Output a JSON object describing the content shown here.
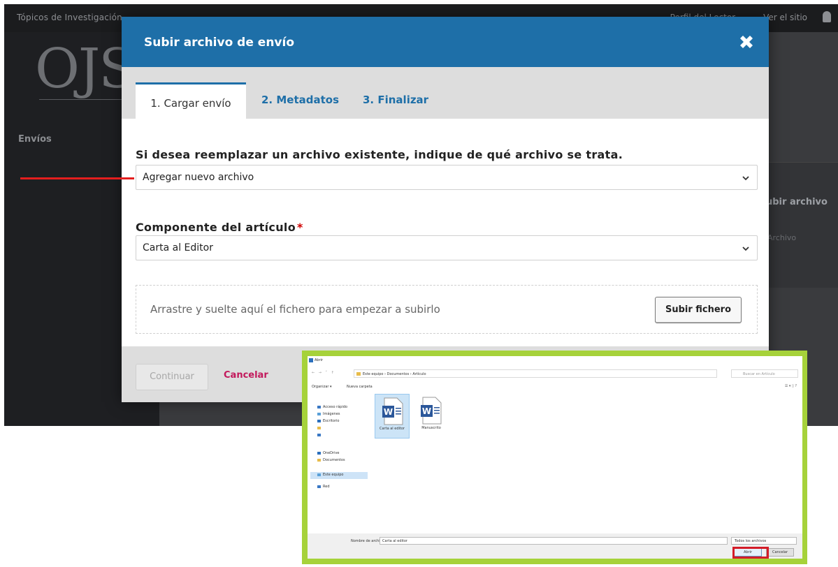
{
  "background": {
    "topbar_left": "Tópicos de Investigación",
    "topbar_right_1": "Perfil del Lector",
    "topbar_right_2": "Ver el sitio",
    "logo_text": "OJS",
    "sidebar_item": "Envíos",
    "panel_link": "ubir archivo",
    "panel_small": "Archivo"
  },
  "modal": {
    "title": "Subir archivo de envío",
    "tabs": [
      {
        "label": "1. Cargar envío"
      },
      {
        "label": "2. Metadatos"
      },
      {
        "label": "3. Finalizar"
      }
    ],
    "replace_label": "Si desea reemplazar un archivo existente, indique de qué archivo se trata.",
    "replace_value": "Agregar nuevo archivo",
    "component_label": "Componente del artículo",
    "required_mark": "*",
    "component_value": "Carta al Editor",
    "dropzone_text": "Arrastre y suelte aquí el fichero para empezar a subirlo",
    "upload_button": "Subir fichero",
    "continue_button": "Continuar",
    "cancel_button": "Cancelar"
  },
  "colors": {
    "header_blue": "#1e6fa8",
    "link_blue": "#1e6fa8",
    "cancel_pink": "#c2185b",
    "highlight_green": "#a6d23a",
    "annotation_red": "#e41e1e"
  },
  "file_dialog": {
    "title": "Abrir",
    "address_path": "Este equipo  ›  Documentos  ›  Artículo",
    "search_placeholder": "Buscar en Artículo",
    "organize": "Organizar ▾",
    "new_folder": "Nueva carpeta",
    "sidebar": [
      {
        "label": "Acceso rápido"
      },
      {
        "label": "Imágenes"
      },
      {
        "label": "Escritorio"
      },
      {
        "label": ""
      },
      {
        "label": ""
      },
      {
        "label": "OneDrive"
      },
      {
        "label": "Documentos"
      },
      {
        "label": "Este equipo"
      },
      {
        "label": "Red"
      }
    ],
    "files": [
      {
        "name": "Carta al editor"
      },
      {
        "name": "Manuscrito"
      }
    ],
    "filename_label": "Nombre de archivo:",
    "filename_value": "Carta al editor",
    "filter": "Todos los archivos",
    "open_button": "Abrir",
    "cancel_button": "Cancelar"
  }
}
